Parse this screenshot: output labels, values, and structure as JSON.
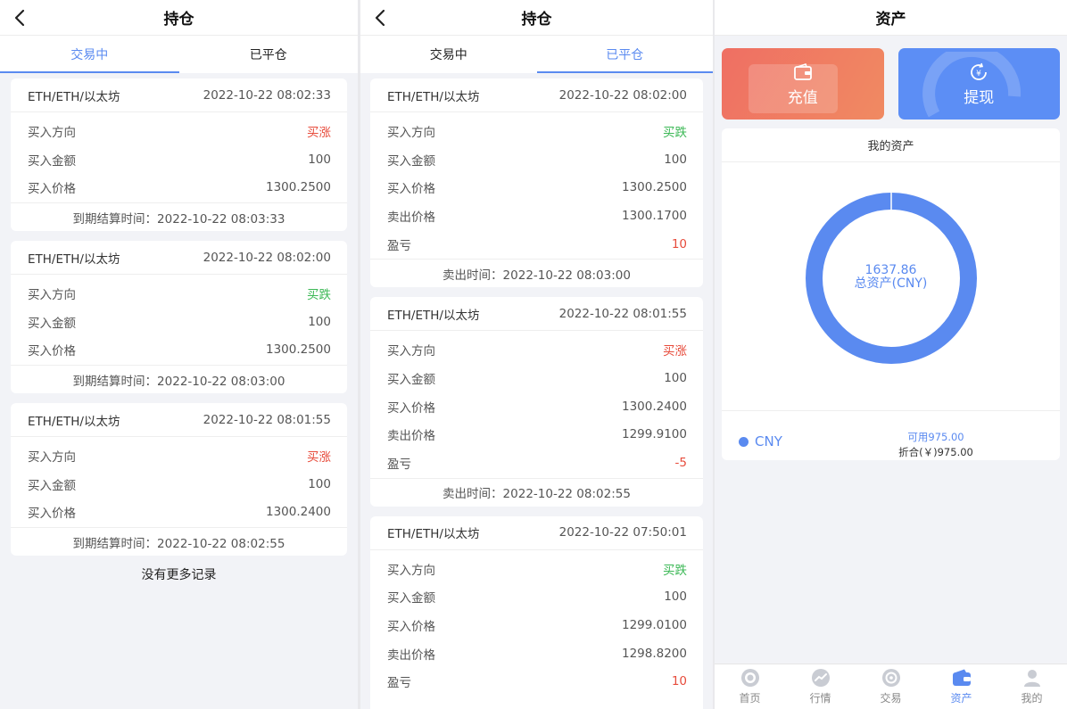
{
  "screen1": {
    "title": "持仓",
    "tabs": [
      {
        "label": "交易中",
        "active": true
      },
      {
        "label": "已平仓",
        "active": false
      }
    ],
    "cards": [
      {
        "pair": "ETH/ETH/以太坊",
        "time": "2022-10-22 08:02:33",
        "rows": [
          {
            "label": "买入方向",
            "value": "买涨",
            "tone": "up"
          },
          {
            "label": "买入金额",
            "value": "100"
          },
          {
            "label": "买入价格",
            "value": "1300.2500"
          }
        ],
        "footer": "到期结算时间：2022-10-22 08:03:33"
      },
      {
        "pair": "ETH/ETH/以太坊",
        "time": "2022-10-22 08:02:00",
        "rows": [
          {
            "label": "买入方向",
            "value": "买跌",
            "tone": "down"
          },
          {
            "label": "买入金额",
            "value": "100"
          },
          {
            "label": "买入价格",
            "value": "1300.2500"
          }
        ],
        "footer": "到期结算时间：2022-10-22 08:03:00"
      },
      {
        "pair": "ETH/ETH/以太坊",
        "time": "2022-10-22 08:01:55",
        "rows": [
          {
            "label": "买入方向",
            "value": "买涨",
            "tone": "up"
          },
          {
            "label": "买入金额",
            "value": "100"
          },
          {
            "label": "买入价格",
            "value": "1300.2400"
          }
        ],
        "footer": "到期结算时间：2022-10-22 08:02:55"
      }
    ],
    "no_more": "没有更多记录"
  },
  "screen2": {
    "title": "持仓",
    "tabs": [
      {
        "label": "交易中",
        "active": false
      },
      {
        "label": "已平仓",
        "active": true
      }
    ],
    "cards": [
      {
        "pair": "ETH/ETH/以太坊",
        "time": "2022-10-22 08:02:00",
        "rows": [
          {
            "label": "买入方向",
            "value": "买跌",
            "tone": "down"
          },
          {
            "label": "买入金额",
            "value": "100"
          },
          {
            "label": "买入价格",
            "value": "1300.2500"
          },
          {
            "label": "卖出价格",
            "value": "1300.1700"
          },
          {
            "label": "盈亏",
            "value": "10",
            "tone": "red"
          }
        ],
        "footer": "卖出时间：2022-10-22 08:03:00"
      },
      {
        "pair": "ETH/ETH/以太坊",
        "time": "2022-10-22 08:01:55",
        "rows": [
          {
            "label": "买入方向",
            "value": "买涨",
            "tone": "up"
          },
          {
            "label": "买入金额",
            "value": "100"
          },
          {
            "label": "买入价格",
            "value": "1300.2400"
          },
          {
            "label": "卖出价格",
            "value": "1299.9100"
          },
          {
            "label": "盈亏",
            "value": "-5",
            "tone": "red"
          }
        ],
        "footer": "卖出时间：2022-10-22 08:02:55"
      },
      {
        "pair": "ETH/ETH/以太坊",
        "time": "2022-10-22 07:50:01",
        "rows": [
          {
            "label": "买入方向",
            "value": "买跌",
            "tone": "down"
          },
          {
            "label": "买入金额",
            "value": "100"
          },
          {
            "label": "买入价格",
            "value": "1299.0100"
          },
          {
            "label": "卖出价格",
            "value": "1298.8200"
          },
          {
            "label": "盈亏",
            "value": "10",
            "tone": "red"
          }
        ],
        "footer": ""
      }
    ]
  },
  "screen3": {
    "title": "资产",
    "recharge_label": "充值",
    "withdraw_label": "提现",
    "assets_title": "我的资产",
    "total_value": "1637.86",
    "total_label": "总资产(CNY)",
    "currency": "CNY",
    "available": "可用975.00",
    "converted": "折合(￥)975.00",
    "tabbar": [
      {
        "label": "首页",
        "icon": "home-icon",
        "active": false
      },
      {
        "label": "行情",
        "icon": "market-icon",
        "active": false
      },
      {
        "label": "交易",
        "icon": "trade-icon",
        "active": false
      },
      {
        "label": "资产",
        "icon": "wallet-icon",
        "active": true
      },
      {
        "label": "我的",
        "icon": "user-icon",
        "active": false
      }
    ]
  },
  "colors": {
    "accent": "#5a8af0",
    "up": "#e74c3c",
    "down": "#3cb856",
    "recharge": "#ef7563",
    "withdraw": "#5c8ef5"
  },
  "chart_data": {
    "type": "pie",
    "categories": [
      "CNY"
    ],
    "values": [
      1637.86
    ],
    "title": "我的资产"
  }
}
